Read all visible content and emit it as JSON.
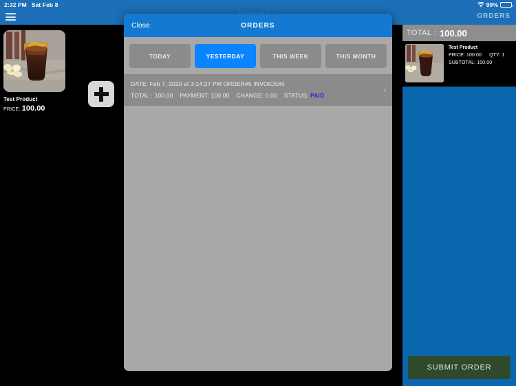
{
  "statusbar": {
    "time": "2:32 PM",
    "date": "Sat Feb 8",
    "wifi_icon": "wifi-icon",
    "battery_percent": "99%",
    "battery_level": 99
  },
  "appbar": {
    "menu_icon": "hamburger-menu-icon",
    "title": "MOBIPOS",
    "orders_label": "ORDERS"
  },
  "products": {
    "items": [
      {
        "name": "Test Product",
        "price_label": "PRICE:",
        "price_value": "100.00",
        "image": "iced-coffee-photo"
      }
    ],
    "add_button_icon": "plus-icon"
  },
  "cart": {
    "total_label": "TOTAL :",
    "total_value": "100.00",
    "items": [
      {
        "name": "Test Product",
        "price_text": "PRICE: 100.00",
        "qty_text": "QTY: 1",
        "subtotal_text": "SUBTOTAL: 100.00",
        "image": "iced-coffee-photo"
      }
    ],
    "submit_label": "SUBMIT ORDER"
  },
  "modal": {
    "close_label": "Close",
    "title": "ORDERS",
    "tabs": [
      {
        "label": "TODAY",
        "active": false
      },
      {
        "label": "YESTERDAY",
        "active": true
      },
      {
        "label": "THIS WEEK",
        "active": false
      },
      {
        "label": "THIS MONTH",
        "active": false
      }
    ],
    "orders": [
      {
        "line1": "DATE: Feb 7, 2020 at 3:14:27 PM   ORDER#5   INVOICE#5",
        "total_text": "TOTAL :  100.00",
        "payment_text": "PAYMENT: 100.00",
        "change_text": "CHANGE: 0.00",
        "status_label": "STATUS:",
        "status_value": "PAID",
        "chevron_icon": "chevron-right-icon"
      }
    ]
  },
  "colors": {
    "accent_blue": "#0a84ff",
    "header_blue": "#1479d1",
    "cart_blue": "#0a66ad",
    "status_paid": "#2b2bd6",
    "submit_green": "#2f4a2b"
  }
}
